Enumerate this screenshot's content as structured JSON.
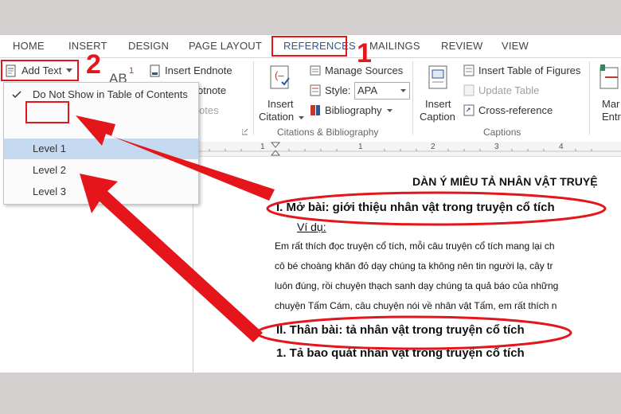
{
  "tabs": [
    "HOME",
    "INSERT",
    "DESIGN",
    "PAGE LAYOUT",
    "REFERENCES",
    "MAILINGS",
    "REVIEW",
    "VIEW"
  ],
  "active_tab": "REFERENCES",
  "ribbon": {
    "add_text": "Add Text",
    "ab_label": "AB",
    "ab_sup": "1",
    "insert_endnote": "Insert Endnote",
    "footnote_partial": "otnote",
    "notes_partial": "otes",
    "insert_citation_1": "Insert",
    "insert_citation_2": "Citation",
    "manage_sources": "Manage Sources",
    "style_label": "Style:",
    "style_value": "APA",
    "bibliography": "Bibliography",
    "citations_group": "Citations & Bibliography",
    "insert_caption_1": "Insert",
    "insert_caption_2": "Caption",
    "insert_table_of_figures": "Insert Table of Figures",
    "update_table": "Update Table",
    "cross_reference": "Cross-reference",
    "captions_group": "Captions",
    "mark_entry_1": "Mar",
    "mark_entry_2": "Entr"
  },
  "dropdown": {
    "items": [
      "Do Not Show in Table of Contents",
      "Level 1",
      "Level 2",
      "Level 3"
    ],
    "selected": "Level 1"
  },
  "ruler_numbers": [
    "1",
    "2",
    "1",
    "2",
    "3",
    "4"
  ],
  "document": {
    "title": "DÀN Ý MIÊU TẢ NHÂN VẬT TRUYỆ",
    "heading1": "I.   Mở bài: giới thiệu nhân vật trong truyện cổ tích",
    "example": "Ví dụ:",
    "para_lines": [
      "Em rất thích đọc truyện cổ tích, mỗi câu truyện cổ tích mang lại ch",
      "cô bé choàng khăn đỏ dạy chúng ta không nên tin người lạ, cây tr",
      "luôn đúng, rồi chuyện thạch sanh dạy chúng ta quả báo của những",
      "chuyện Tấm Cám, câu chuyện nói về nhân vật Tấm, em rất thích n"
    ],
    "heading2": "II.  Thân bài: tả nhân vật trong truyện cổ tích",
    "subheading": "1. Tả bao quát nhân vật trong truyện cổ tích"
  },
  "annotations": {
    "step1": "1",
    "step2": "2",
    "accent_color": "#e4161b"
  }
}
